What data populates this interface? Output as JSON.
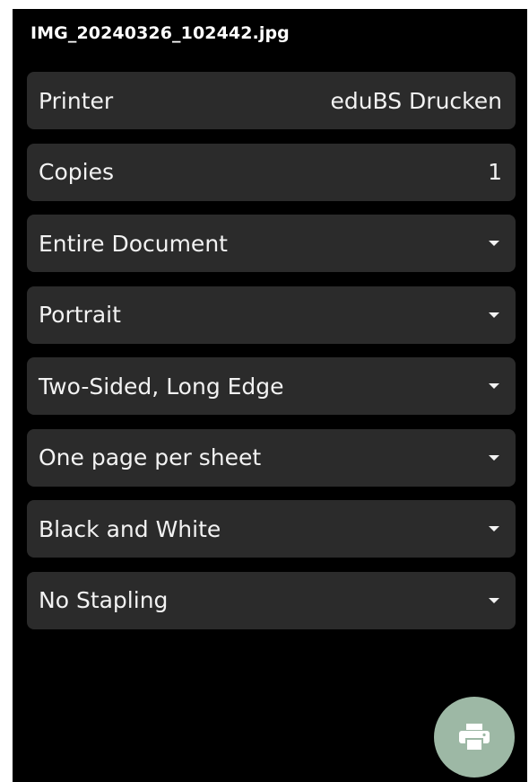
{
  "header": {
    "file_name": "IMG_20240326_102442.jpg"
  },
  "options": {
    "printer": {
      "label": "Printer",
      "value": "eduBS Drucken"
    },
    "copies": {
      "label": "Copies",
      "value": "1"
    },
    "page_range": {
      "selected": "Entire Document"
    },
    "orientation": {
      "selected": "Portrait"
    },
    "duplex": {
      "selected": "Two-Sided, Long Edge"
    },
    "pages_per_sheet": {
      "selected": "One page per sheet"
    },
    "color_mode": {
      "selected": "Black and White"
    },
    "stapling": {
      "selected": "No Stapling"
    }
  },
  "fab": {
    "icon": "printer-icon",
    "color": "#9db8a5"
  },
  "theme": {
    "background": "#000000",
    "row_background": "#2b2b2b",
    "text": "#f2f2f2"
  }
}
